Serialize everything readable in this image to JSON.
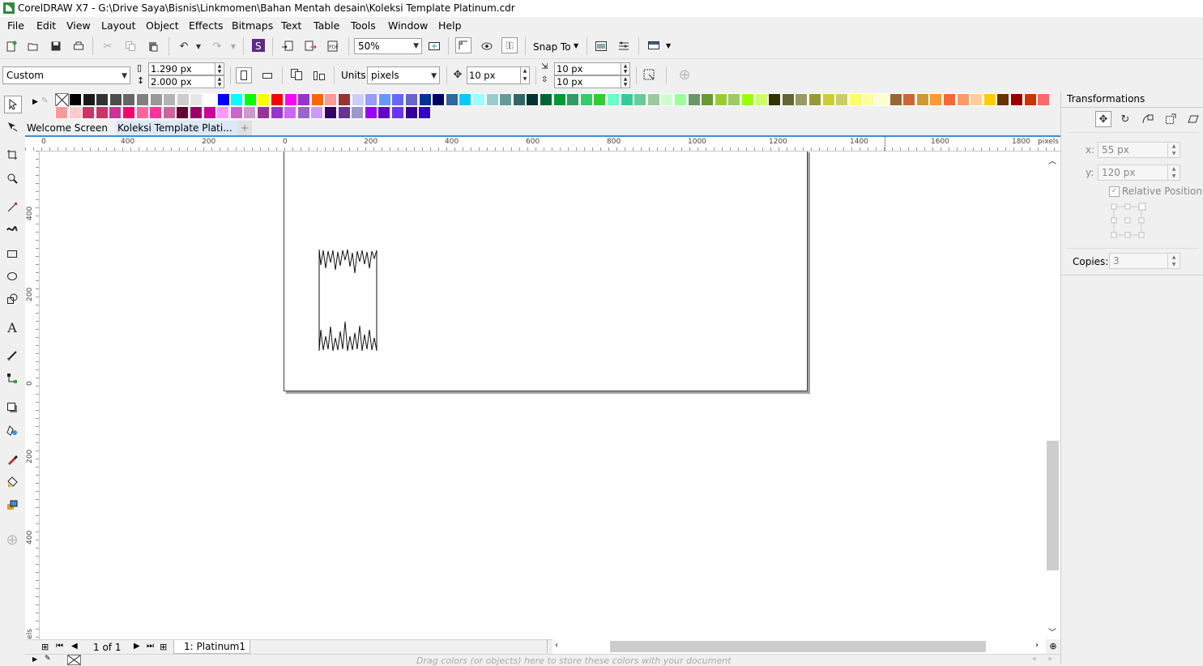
{
  "window": {
    "title": "CorelDRAW X7 - G:\\Drive Saya\\Bisnis\\Linkmomen\\Bahan Mentah desain\\Koleksi Template Platinum.cdr"
  },
  "menu": [
    {
      "label": "File"
    },
    {
      "label": "Edit"
    },
    {
      "label": "View"
    },
    {
      "label": "Layout"
    },
    {
      "label": "Object"
    },
    {
      "label": "Effects"
    },
    {
      "label": "Bitmaps"
    },
    {
      "label": "Text"
    },
    {
      "label": "Table"
    },
    {
      "label": "Tools"
    },
    {
      "label": "Window"
    },
    {
      "label": "Help"
    }
  ],
  "toolbar": {
    "zoom": "50%",
    "snap_to": "Snap To"
  },
  "propbar": {
    "page_size": "Custom",
    "width": "1.290 px",
    "height": "2.000 px",
    "units_label": "Units:",
    "units_value": "pixels",
    "nudge": "10 px",
    "dup_x": "10 px",
    "dup_y": "10 px"
  },
  "palette": {
    "row1": [
      "#000000",
      "#1a1a1a",
      "#333333",
      "#4d4d4d",
      "#666666",
      "#808080",
      "#999999",
      "#b3b3b3",
      "#cccccc",
      "#e6e6e6",
      "#ffffff",
      "#0000ff",
      "#00ffff",
      "#00ff00",
      "#ffff00",
      "#ff0000",
      "#ff00ff",
      "#9933cc",
      "#ff6600",
      "#ff9999",
      "#993333",
      "#ccccff",
      "#9999ff",
      "#6699ff",
      "#6666ff",
      "#6666cc",
      "#003399",
      "#000066",
      "#336699",
      "#00ccff",
      "#99ffff",
      "#99cccc",
      "#669999",
      "#336666",
      "#003333",
      "#006633",
      "#009933",
      "#339966",
      "#33cc66",
      "#33cc33",
      "#66ffcc",
      "#33cc99",
      "#66cc99",
      "#99cc99",
      "#ccffcc",
      "#99ff99",
      "#669966",
      "#669933",
      "#99cc33",
      "#99cc66",
      "#99ff00",
      "#ccff66",
      "#333300",
      "#666633",
      "#999966",
      "#999933",
      "#cccc33",
      "#cccc66",
      "#ffff66",
      "#ffff99",
      "#ffffcc",
      "#996633",
      "#cc6633",
      "#cc9933",
      "#ff9933",
      "#ff6633",
      "#ff9966",
      "#ffcc99",
      "#ffcc00",
      "#663300",
      "#990000",
      "#cc3300",
      "#ff6666"
    ],
    "row2": [
      "#ff9999",
      "#ffcccc",
      "#cc3366",
      "#cc3366",
      "#cc3399",
      "#ff0066",
      "#ff6699",
      "#ff3399",
      "#cc6699",
      "#660033",
      "#990066",
      "#cc0099",
      "#ff99ff",
      "#cc66cc",
      "#cc99cc",
      "#993399",
      "#9933cc",
      "#cc66ff",
      "#9966cc",
      "#cc99ff",
      "#330066",
      "#663399",
      "#9999cc",
      "#9900ff",
      "#6600cc",
      "#6633ff",
      "#330099",
      "#3300cc"
    ]
  },
  "tabs": {
    "welcome": "Welcome Screen",
    "document": "Koleksi Template Plati..."
  },
  "ruler": {
    "h_labels": [
      "0",
      "400",
      "200",
      "0",
      "200",
      "400",
      "600",
      "800",
      "1000",
      "1200",
      "1400",
      "1600",
      "1800"
    ],
    "h_unit": "pixels",
    "v_labels": [
      "400",
      "200",
      "0",
      "200",
      "400"
    ],
    "v_unit": "pixels"
  },
  "pages": {
    "counter": "1 of 1",
    "page_tab": "1: Platinum1"
  },
  "docpalette": {
    "hint": "Drag colors (or objects) here to store these colors with your document"
  },
  "docker": {
    "title": "Transformations",
    "x_label": "x:",
    "x_value": "55 px",
    "y_label": "y:",
    "y_value": "120 px",
    "relative_position": "Relative Position",
    "copies_label": "Copies:",
    "copies_value": "3"
  },
  "colors": {
    "accent": "#3c8fd6",
    "chrome": "#f0f0f0",
    "scroll_thumb": "#cdcdcd"
  }
}
